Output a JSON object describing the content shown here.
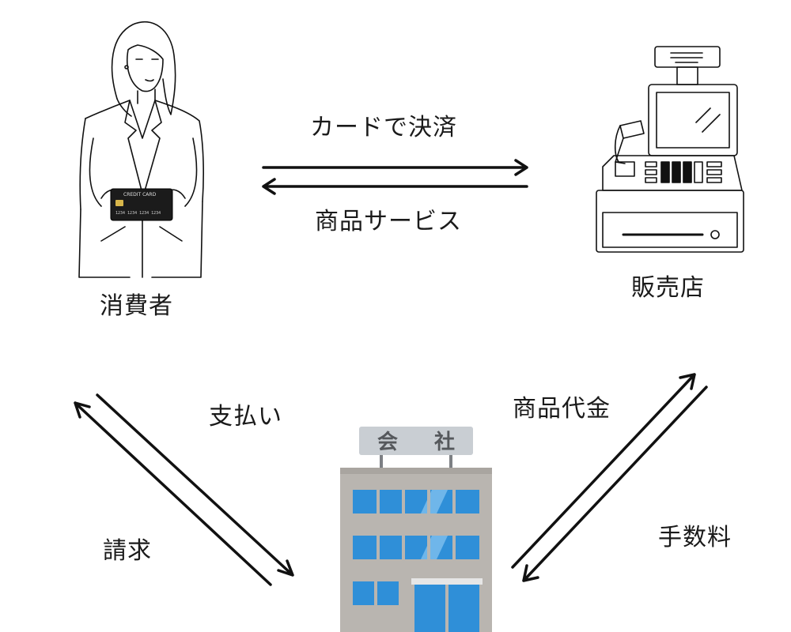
{
  "nodes": {
    "consumer": {
      "label": "消費者",
      "card_text": "CREDIT CARD"
    },
    "merchant": {
      "label": "販売店"
    },
    "company": {
      "label": "会　社",
      "sign_chars": [
        "会",
        "社"
      ]
    }
  },
  "flows": {
    "consumer_to_merchant": "カードで決済",
    "merchant_to_consumer": "商品サービス",
    "consumer_to_company": "支払い",
    "company_to_consumer": "請求",
    "company_to_merchant": "商品代金",
    "merchant_to_company": "手数料"
  },
  "colors": {
    "stroke": "#111111",
    "building_gray": "#b9b5b0",
    "building_dark": "#9e9a95",
    "window_blue": "#2f8fd8",
    "window_light": "#6fb6ea",
    "sign_bg": "#c9ced3"
  }
}
